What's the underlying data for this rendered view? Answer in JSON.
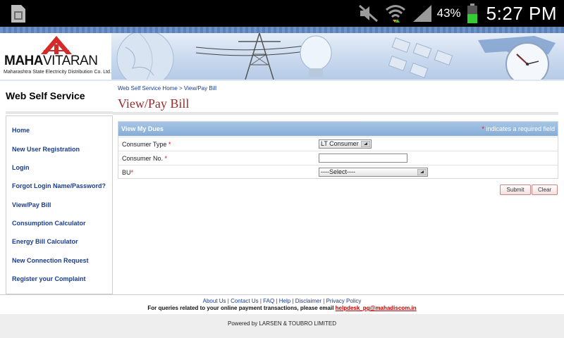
{
  "status_bar": {
    "battery_percent": "43%",
    "time": "5:27 PM"
  },
  "header": {
    "logo_bold": "MAHA",
    "logo_light": "VITARAN",
    "logo_subtitle": "Maharashtra State Electricity Distribution Co. Ltd."
  },
  "sidebar": {
    "title": "Web Self Service",
    "items": [
      {
        "label": "Home"
      },
      {
        "label": "New User Registration"
      },
      {
        "label": "Login"
      },
      {
        "label": "Forgot Login Name/Password?"
      },
      {
        "label": "View/Pay Bill"
      },
      {
        "label": "Consumption Calculator"
      },
      {
        "label": "Energy Bill Calculator"
      },
      {
        "label": "New Connection Request"
      },
      {
        "label": "Register your Complaint"
      }
    ]
  },
  "breadcrumb": {
    "home": "Web Self Service Home",
    "separator": " > ",
    "current": "View/Pay Bill"
  },
  "page_title": "View/Pay Bill",
  "form": {
    "section_title": "View My Dues",
    "required_star": "*",
    "required_note": " indicates a required field",
    "rows": [
      {
        "label": "Consumer Type",
        "star": " *",
        "value": "LT Consumer"
      },
      {
        "label": "Consumer No.",
        "star": " *",
        "value": ""
      },
      {
        "label": "BU",
        "star": "*",
        "value": "----Select----"
      }
    ]
  },
  "buttons": {
    "submit": "Submit",
    "clear": "Clear"
  },
  "footer": {
    "links": [
      "About Us",
      "Contact Us",
      "FAQ",
      "Help",
      "Disclaimer",
      "Privacy Policy"
    ],
    "link_separator": " | ",
    "query_text": "For queries related to your online payment transactions, please email ",
    "email": "helpdesk_pg@mahadiscom.in",
    "powered_by": "Powered by LARSEN & TOUBRO LIMITED"
  },
  "colors": {
    "link_blue": "#1a3d8f",
    "title_maroon": "#9c2a2a",
    "form_header_blue": "#86acd6",
    "required_red": "#e00000",
    "logo_red": "#d32a2a"
  }
}
